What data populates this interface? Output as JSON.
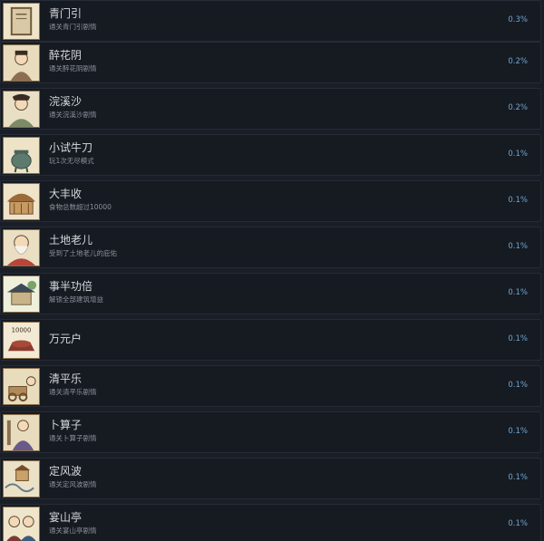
{
  "achievements": [
    {
      "title": "青门引",
      "desc": "通关青门引剧情",
      "pct": "0.3%",
      "icon": "book-icon"
    },
    {
      "title": "醉花阴",
      "desc": "通关醉花阴剧情",
      "pct": "0.2%",
      "icon": "drunk-scholar-icon"
    },
    {
      "title": "浣溪沙",
      "desc": "通关浣溪沙剧情",
      "pct": "0.2%",
      "icon": "washing-woman-icon"
    },
    {
      "title": "小试牛刀",
      "desc": "玩1次无尽模式",
      "pct": "0.1%",
      "icon": "bronze-vessel-icon"
    },
    {
      "title": "大丰收",
      "desc": "食物总数超过10000",
      "pct": "0.1%",
      "icon": "granary-icon"
    },
    {
      "title": "土地老儿",
      "desc": "受到了土地老儿的庇佑",
      "pct": "0.1%",
      "icon": "earth-god-icon"
    },
    {
      "title": "事半功倍",
      "desc": "解锁全部建筑增益",
      "pct": "0.1%",
      "icon": "pavilion-icon"
    },
    {
      "title": "万元户",
      "desc": "",
      "pct": "0.1%",
      "icon": "treasure-10000-icon",
      "icon_text": "10000"
    },
    {
      "title": "清平乐",
      "desc": "通关清平乐剧情",
      "pct": "0.1%",
      "icon": "cart-scene-icon"
    },
    {
      "title": "卜算子",
      "desc": "通关卜算子剧情",
      "pct": "0.1%",
      "icon": "fortune-teller-icon"
    },
    {
      "title": "定风波",
      "desc": "通关定风波剧情",
      "pct": "0.1%",
      "icon": "storm-scene-icon"
    },
    {
      "title": "宴山亭",
      "desc": "通关宴山亭剧情",
      "pct": "0.1%",
      "icon": "banquet-people-icon"
    }
  ],
  "colors": {
    "background": "#1a1e26",
    "row_background": "#161a21",
    "title": "#d6d9de",
    "desc": "#8b929c",
    "percent": "#6ea7d4",
    "icon_paper": "#efe4c9"
  }
}
